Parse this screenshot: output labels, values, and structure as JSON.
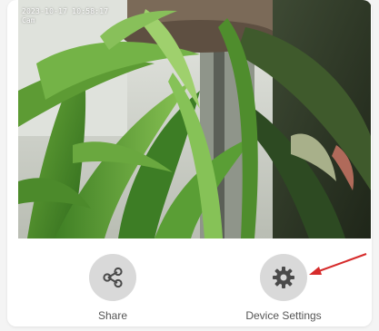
{
  "camera": {
    "timestamp": "2023-10-17 10:58:17",
    "channel": "Cam"
  },
  "actions": {
    "share": {
      "label": "Share",
      "icon": "share-icon"
    },
    "device_settings": {
      "label": "Device Settings",
      "icon": "gear-icon"
    }
  },
  "colors": {
    "icon_bg": "#d9d9d9",
    "icon_fg": "#4a4a4a",
    "label": "#555555",
    "annotation_arrow": "#d62b2b"
  }
}
